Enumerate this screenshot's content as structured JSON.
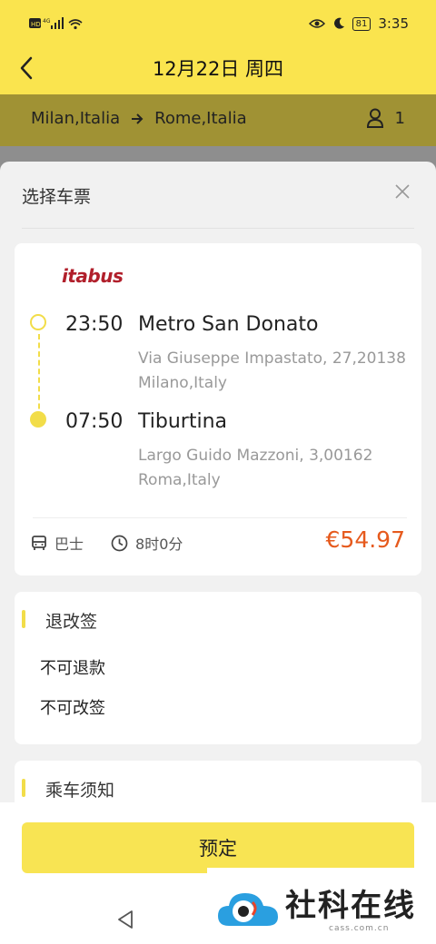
{
  "status_bar": {
    "left_icons": "HD 4G signal wifi",
    "battery": "81",
    "time": "3:35"
  },
  "header": {
    "title": "12月22日 周四"
  },
  "route": {
    "from": "Milan,Italia",
    "to": "Rome,Italia",
    "passengers": "1"
  },
  "sheet": {
    "title": "选择车票"
  },
  "trip": {
    "operator_logo": "itabus",
    "departure": {
      "time": "23:50",
      "station": "Metro San Donato",
      "address": "Via Giuseppe Impastato, 27,20138 Milano,Italy"
    },
    "arrival": {
      "time": "07:50",
      "station": "Tiburtina",
      "address": "Largo Guido Mazzoni, 3,00162 Roma,Italy"
    },
    "vehicle_type": "巴士",
    "duration": "8时0分",
    "price": "€54.97"
  },
  "policy": {
    "title": "退改签",
    "lines": [
      "不可退款",
      "不可改签"
    ]
  },
  "notice": {
    "title": "乘车须知"
  },
  "footer": {
    "book_label": "预定"
  },
  "watermark": {
    "text": "社科在线",
    "sub": "cass.com.cn"
  },
  "colors": {
    "brand_yellow": "#fae44e",
    "price": "#e65a1d",
    "logo_red": "#b11f2b"
  }
}
